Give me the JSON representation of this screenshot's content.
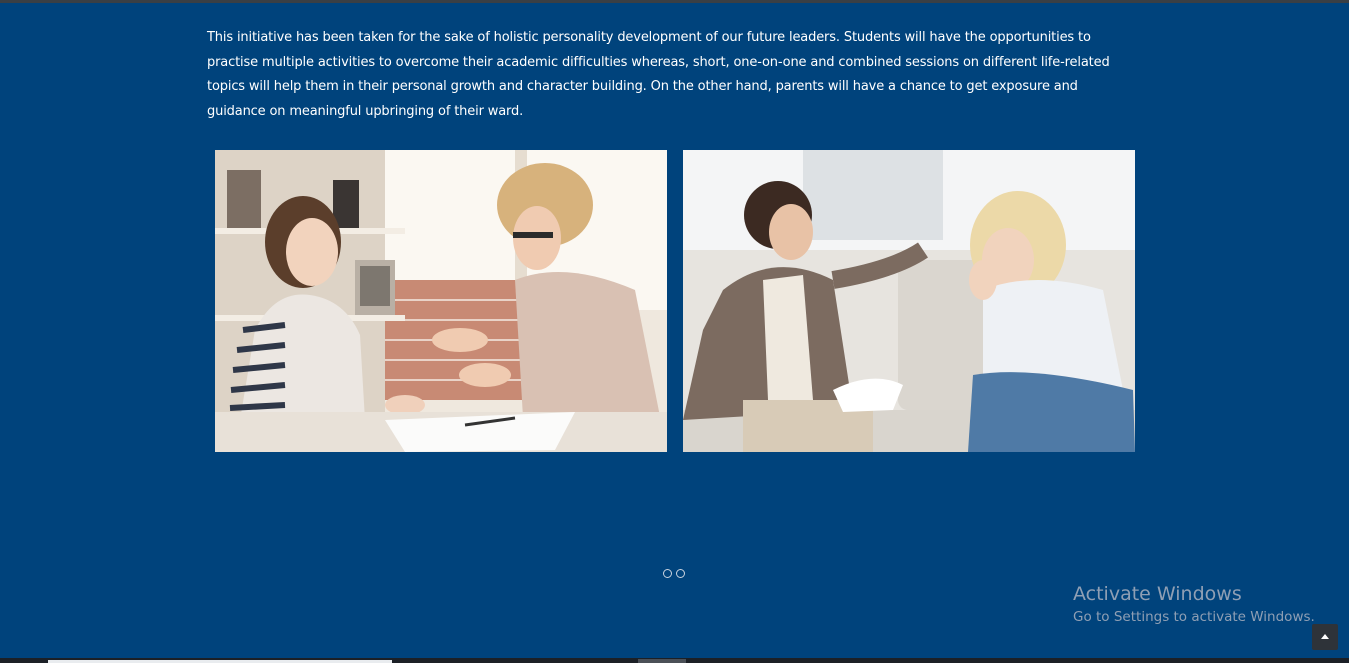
{
  "intro": {
    "text": "This initiative has been taken for the sake of holistic personality development of our future leaders. Students will have the opportunities to practise multiple activities to overcome their academic difficulties whereas, short, one-on-one and combined sessions on different life-related topics will help them in their personal growth and character building. On the other hand, parents will have a chance to get exposure and guidance on meaningful upbringing of their ward."
  },
  "carousel": {
    "slide_count": 2
  },
  "watermark": {
    "title": "Activate Windows",
    "subtitle": "Go to Settings to activate Windows."
  },
  "colors": {
    "background": "#00437c",
    "text": "#ffffff"
  }
}
